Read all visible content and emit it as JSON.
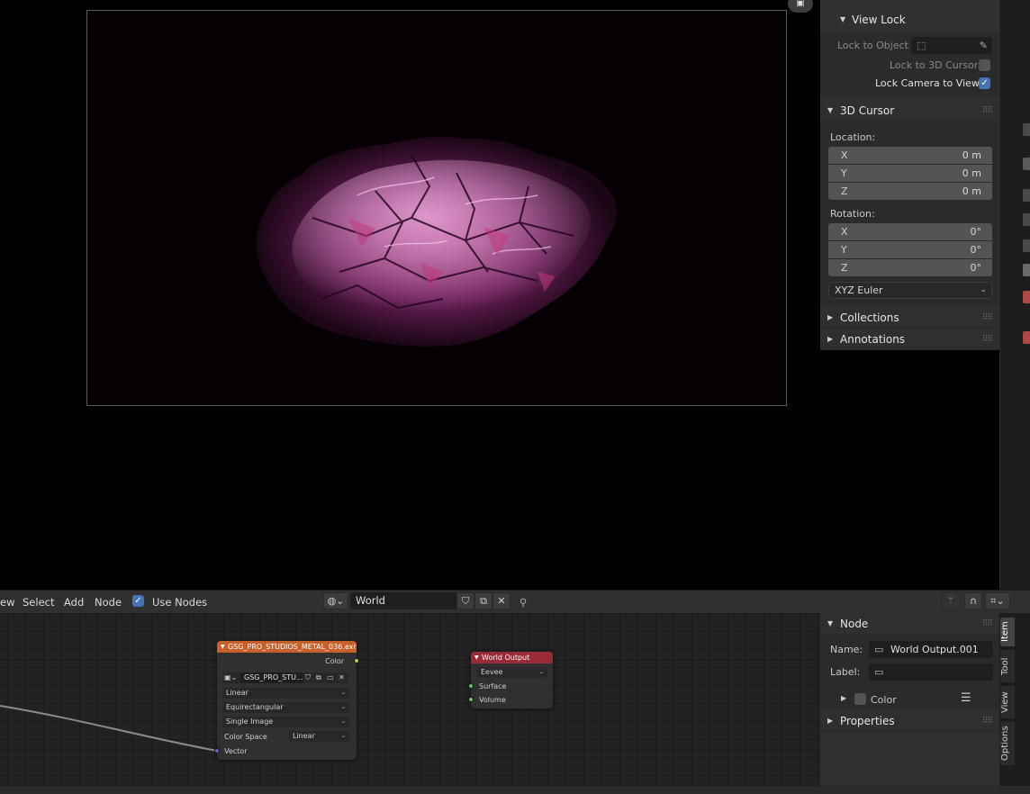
{
  "viewport": {
    "camera_icon": "camera-icon"
  },
  "view_lock": {
    "header": "View Lock",
    "lock_to_object_label": "Lock to Object",
    "lock_to_3d_cursor_label": "Lock to 3D Cursor",
    "lock_to_3d_cursor_checked": false,
    "lock_camera_to_view_label": "Lock Camera to View",
    "lock_camera_to_view_checked": true
  },
  "cursor_3d": {
    "header": "3D Cursor",
    "location_label": "Location:",
    "location": [
      {
        "axis": "X",
        "value": "0 m"
      },
      {
        "axis": "Y",
        "value": "0 m"
      },
      {
        "axis": "Z",
        "value": "0 m"
      }
    ],
    "rotation_label": "Rotation:",
    "rotation": [
      {
        "axis": "X",
        "value": "0°"
      },
      {
        "axis": "Y",
        "value": "0°"
      },
      {
        "axis": "Z",
        "value": "0°"
      }
    ],
    "rotation_mode": "XYZ Euler"
  },
  "collapsed_panels": [
    "Collections",
    "Annotations"
  ],
  "node_header": {
    "menu": [
      "ew",
      "Select",
      "Add",
      "Node"
    ],
    "use_nodes_label": "Use Nodes",
    "use_nodes_checked": true,
    "world_name": "World"
  },
  "image_node": {
    "title": "GSG_PRO_STUDIOS_METAL_036.exr",
    "output_label": "Color",
    "image_name": "GSG_PRO_STU...",
    "interpolation": "Linear",
    "projection": "Equirectangular",
    "source": "Single Image",
    "color_space_label": "Color Space",
    "color_space": "Linear",
    "input_label": "Vector",
    "header_color": "#c7602a"
  },
  "output_node": {
    "title": "World Output",
    "target": "Eevee",
    "inputs": [
      "Surface",
      "Volume"
    ],
    "header_color": "#9b2a38"
  },
  "node_panel": {
    "header": "Node",
    "name_label": "Name:",
    "name_value": "World Output.001",
    "label_label": "Label:",
    "label_value": "",
    "color_label": "Color",
    "properties_header": "Properties"
  },
  "side_tabs": [
    "Item",
    "Tool",
    "View",
    "Options"
  ],
  "colors": {
    "accent": "#4772b3",
    "socket_color": "#c7c729",
    "socket_vector": "#6363c7",
    "socket_shader": "#63c763"
  }
}
